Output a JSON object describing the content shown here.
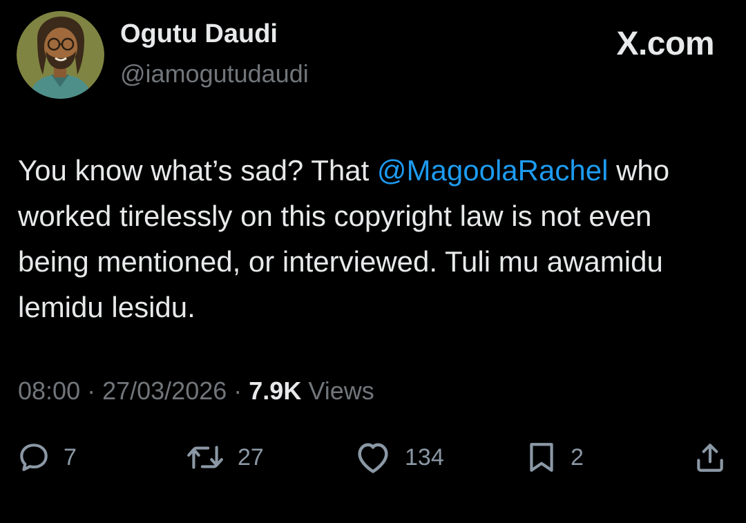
{
  "author": {
    "name": "Ogutu Daudi",
    "handle": "@iamogutudaudi",
    "avatar_icon": "cartoon-portrait-avatar"
  },
  "brand": {
    "text": "X.com"
  },
  "tweet": {
    "text_before": "You know what’s sad? That ",
    "mention": "@MagoolaRachel",
    "text_after": " who worked tirelessly on this copyright law is not even being mentioned, or interviewed. Tuli mu awamidu lemidu lesidu."
  },
  "meta": {
    "time": "08:00",
    "separator": " · ",
    "date": "27/03/2026",
    "views_count": "7.9K",
    "views_label": " Views"
  },
  "actions": {
    "replies": "7",
    "reposts": "27",
    "likes": "134",
    "bookmarks": "2"
  },
  "colors": {
    "background": "#000000",
    "text": "#e7e9ea",
    "secondary": "#71767b",
    "link": "#1d9bf0"
  }
}
